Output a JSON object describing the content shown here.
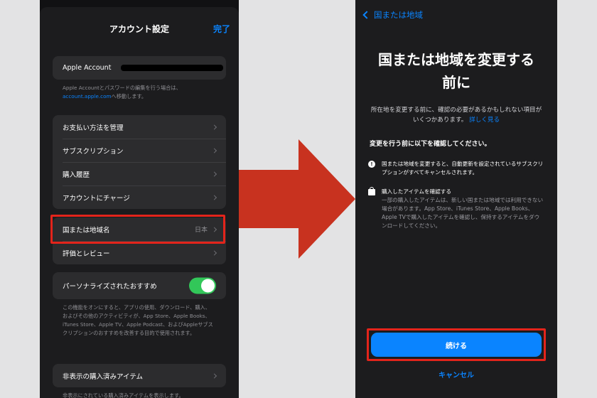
{
  "left_screen": {
    "title": "アカウント設定",
    "done_label": "完了",
    "apple_account_label": "Apple Account",
    "account_note_text": "Apple Accountとパスワードの編集を行う場合は、",
    "account_note_link": "account.apple.com",
    "account_note_suffix": "へ移動します。",
    "payment_items": [
      "お支払い方法を管理",
      "サブスクリプション",
      "購入履歴",
      "アカウントにチャージ"
    ],
    "region_label": "国または地域名",
    "region_value": "日本",
    "ratings_label": "評価とレビュー",
    "personalized_label": "パーソナライズされたおすすめ",
    "personalized_on": true,
    "personalized_note": "この機能をオンにすると、アプリの使用、ダウンロード、購入、およびその他のアクティビティが、App Store、Apple Books、iTunes Store、Apple TV、Apple Podcast、およびAppleサブスクリプションのおすすめを改善する目的で使用されます。",
    "hidden_purchases_label": "非表示の購入済みアイテム",
    "hidden_purchases_note": "非表示にされている購入済みアイテムを表示します。"
  },
  "right_screen": {
    "back_label": "国または地域",
    "title_line1": "国または地域を変更する",
    "title_line2": "前に",
    "intro_text": "所在地を変更する前に、確認の必要があるかもしれない項目がいくつかあります。",
    "intro_link": "詳しく見る",
    "section_header": "変更を行う前に以下を確認してください。",
    "item1_text": "国または地域を変更すると、自動更新を設定されているサブスクリプションがすべてキャンセルされます。",
    "item2_title": "購入したアイテムを確認する",
    "item2_desc": "一部の購入したアイテムは、新しい国または地域では利用できない場合があります。App Store、iTunes Store、Apple Books、Apple TVで購入したアイテムを確認し、保持するアイテムをダウンロードしてください。",
    "continue_label": "続ける",
    "cancel_label": "キャンセル"
  },
  "colors": {
    "highlight": "#e3241b",
    "arrow": "#c8321f",
    "accent": "#0a84ff",
    "toggle_on": "#32c759"
  }
}
